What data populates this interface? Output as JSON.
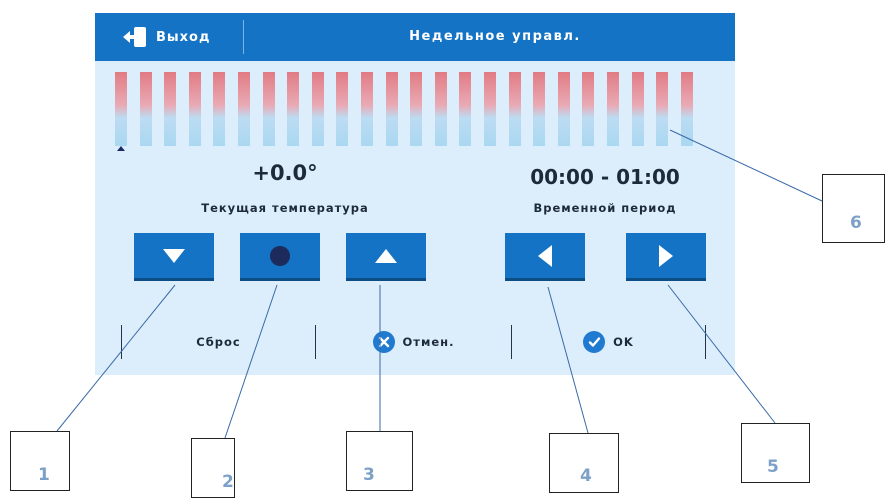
{
  "header": {
    "exit_label": "Выход",
    "title": "Недельное управл."
  },
  "bars": {
    "count": 24,
    "current_hour_index": 0
  },
  "temperature": {
    "value": "+0.0°",
    "label": "Текущая температура"
  },
  "period": {
    "value": "00:00 - 01:00",
    "label": "Временной период"
  },
  "buttons": {
    "down_icon": "arrow-down-icon",
    "middle_icon": "dot-icon",
    "up_icon": "arrow-up-icon",
    "left_icon": "arrow-left-icon",
    "right_icon": "arrow-right-icon"
  },
  "footer": {
    "reset_label": "Сброс",
    "cancel_label": "Отмен.",
    "ok_label": "OK"
  },
  "callouts": [
    "1",
    "2",
    "3",
    "4",
    "5",
    "6"
  ],
  "colors": {
    "accent": "#1473c4",
    "screen_bg": "#dceefb",
    "bar_top": "#e17b84",
    "bar_bottom": "#aad7f1"
  }
}
